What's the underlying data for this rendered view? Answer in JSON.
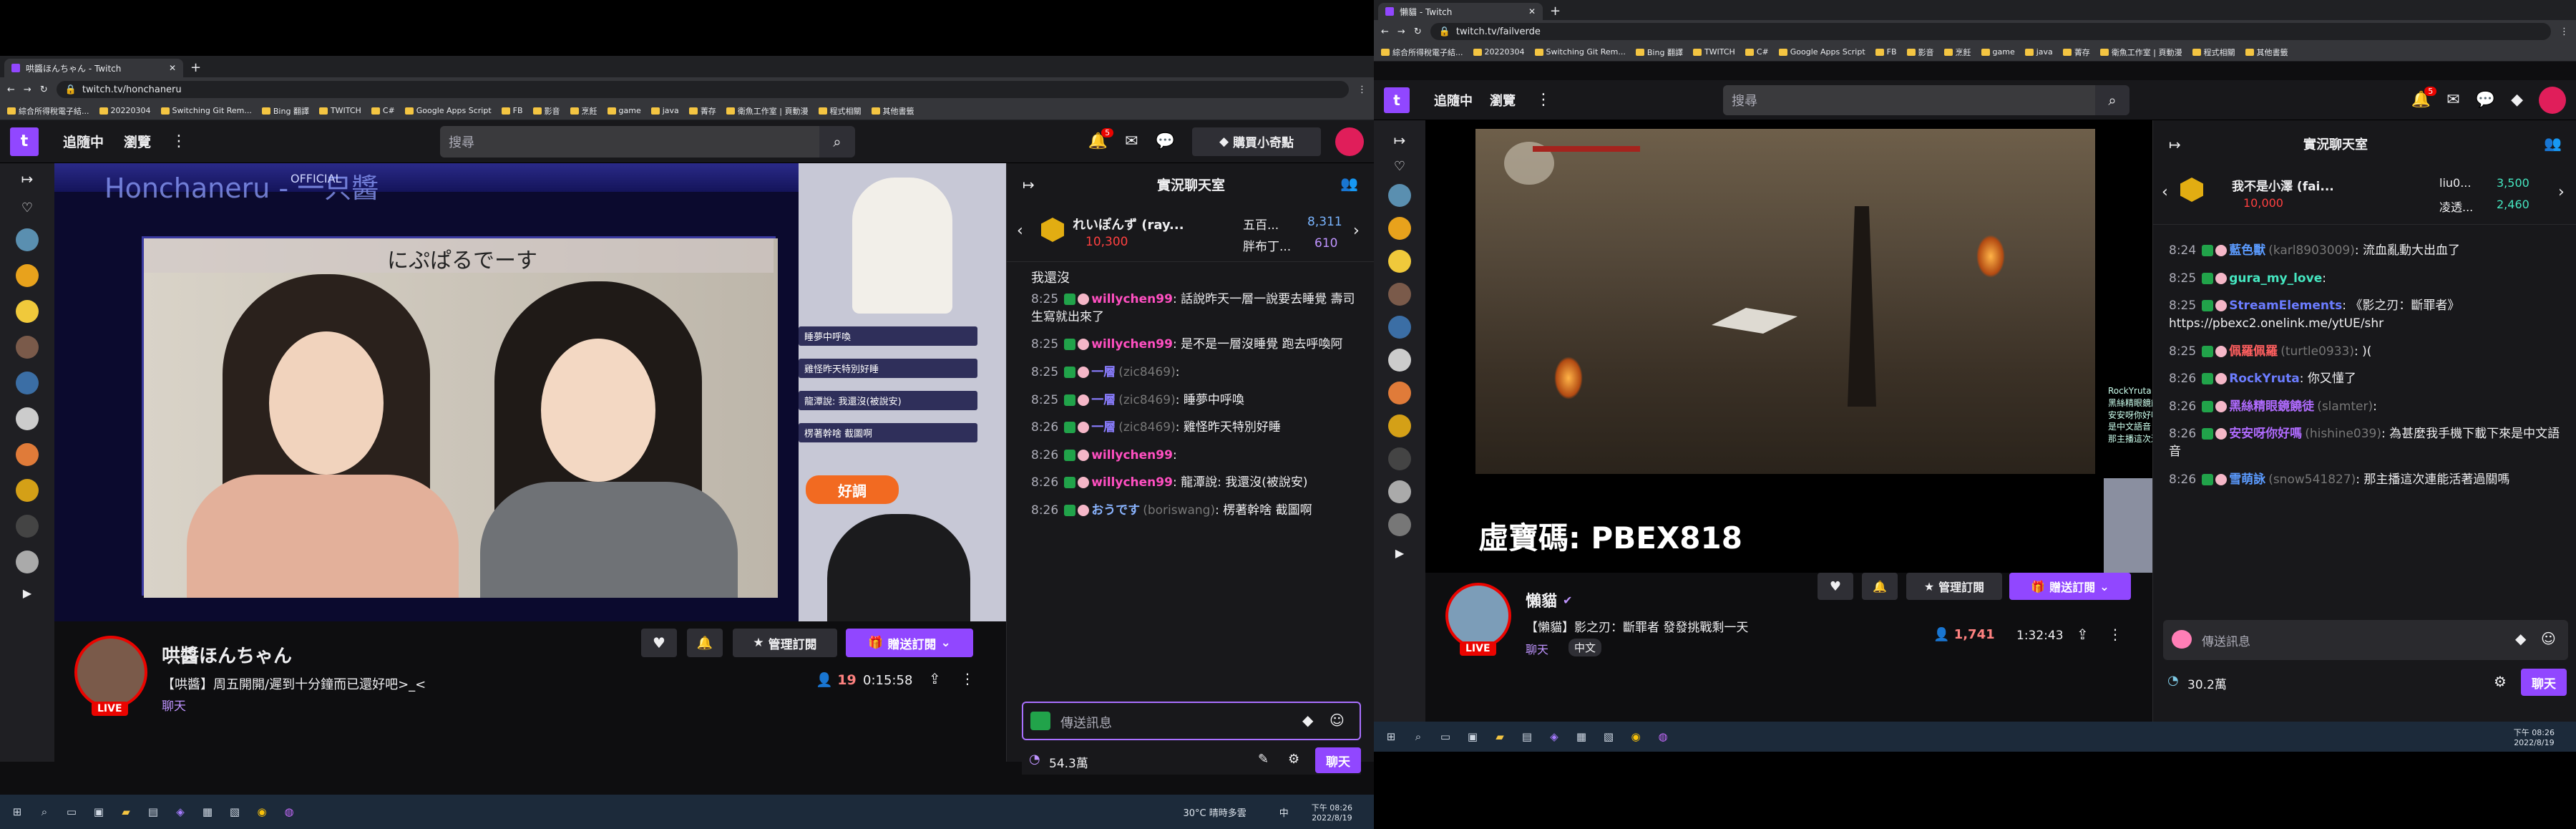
{
  "left": {
    "tab_title": "哄醬ほんちゃん - Twitch",
    "url": "twitch.tv/honchaneru",
    "bookmarks": [
      "綜合所得稅電子結...",
      "20220304",
      "Switching Git Rem...",
      "Bing 翻譯",
      "TWITCH",
      "C#",
      "Google Apps Script",
      "FB",
      "影音",
      "烹飪",
      "game",
      "java",
      "菁存",
      "衛魚工作室 | 頁動漫",
      "程式相關",
      "其他書籤"
    ],
    "nav": {
      "following": "追隨中",
      "browse": "瀏覽",
      "search_placeholder": "搜尋",
      "notif_count": "5",
      "bits_label": "購買小奇點"
    },
    "video": {
      "banner_title": "Honchaneru - 一只醬",
      "official": "OFFICIAL",
      "stream_caption": "にぷぱるでーす",
      "side_overlay": [
        "睡夢中呼喚",
        "雞怪昨天特別好睡",
        "龍潭說: 我還沒(被說安)",
        "楞著幹啥 截圖啊"
      ],
      "good_label": "好調"
    },
    "channel": {
      "name": "哄醬ほんちゃん",
      "title": "【哄醬】周五開開/遲到十分鐘而已還好吧>_<",
      "category": "聊天",
      "live": "LIVE",
      "viewers": "19",
      "uptime": "0:15:58",
      "follow_btn": "管理訂閱",
      "gift_btn": "贈送訂閱"
    },
    "chat": {
      "header": "實況聊天室",
      "pinned": {
        "user": "れいぽんず (ray...",
        "bits": "10,300",
        "user2": "五百...",
        "bits2": "8,311",
        "user3": "胖布丁...",
        "bits3": "610"
      },
      "first_line": "我還沒",
      "messages": [
        {
          "time": "8:25",
          "user": "willychen99",
          "text": ": 話說昨天一層一說要去睡覺 壽司生寫就出來了",
          "color": "#ff4fc1"
        },
        {
          "time": "8:25",
          "user": "willychen99",
          "text": ": 是不是一層沒睡覺 跑去呼喚阿",
          "color": "#ff4fc1"
        },
        {
          "time": "8:25",
          "user": "一層",
          "sub": "(zic8469)",
          "text": ":",
          "color": "#8a7dff"
        },
        {
          "time": "8:25",
          "user": "一層",
          "sub": "(zic8469)",
          "text": ": 睡夢中呼喚",
          "color": "#8a7dff"
        },
        {
          "time": "8:26",
          "user": "一層",
          "sub": "(zic8469)",
          "text": ": 雞怪昨天特別好睡",
          "color": "#8a7dff"
        },
        {
          "time": "8:26",
          "user": "willychen99",
          "text": ":",
          "color": "#ff4fc1"
        },
        {
          "time": "8:26",
          "user": "willychen99",
          "text": ": 龍潭說: 我還沒(被說安)",
          "color": "#ff4fc1"
        },
        {
          "time": "8:26",
          "user": "おうです",
          "sub": "(boriswang)",
          "text": ": 楞著幹啥 截圖啊",
          "color": "#8ab4ff"
        }
      ],
      "input_placeholder": "傳送訊息",
      "points": "54.3萬",
      "send": "聊天"
    },
    "taskbar": {
      "weather": "30°C 晴時多雲",
      "lang": "中",
      "time": "下午 08:26",
      "date": "2022/8/19"
    }
  },
  "right": {
    "tab_title": "懶貓 - Twitch",
    "url": "twitch.tv/failverde",
    "bookmarks": [
      "綜合所得稅電子結...",
      "20220304",
      "Switching Git Rem...",
      "Bing 翻譯",
      "TWITCH",
      "C#",
      "Google Apps Script",
      "FB",
      "影音",
      "烹飪",
      "game",
      "java",
      "菁存",
      "衛魚工作室 | 頁動漫",
      "程式相關",
      "其他書籤"
    ],
    "nav": {
      "following": "追隨中",
      "browse": "瀏覽",
      "search_placeholder": "搜尋",
      "notif_count": "5"
    },
    "video": {
      "code": "虛寶碼: PBEX818",
      "mini_chat": [
        "RockYruta: 你又懂了",
        "黑絲精眼鏡饒徒",
        "安安呀你好嗎: 為甚麼我手機下載下來是中文語音",
        "那主播這次連能活著過關嗎"
      ]
    },
    "channel": {
      "name": "懶貓",
      "title": "【懶貓】影之刃：斷罪者 發發挑戰剩一天",
      "category": "聊天",
      "tag": "中文",
      "live": "LIVE",
      "viewers": "1,741",
      "uptime": "1:32:43",
      "follow_btn": "管理訂閱",
      "gift_btn": "贈送訂閱"
    },
    "chat": {
      "header": "實況聊天室",
      "pinned": {
        "user": "我不是小澤 (fai...",
        "bits": "10,000",
        "user2": "liu0...",
        "bits2": "3,500",
        "user3": "凌透...",
        "bits3": "2,460"
      },
      "messages": [
        {
          "time": "8:24",
          "user": "藍色獸",
          "sub": "(karl8903009)",
          "text": ": 流血亂動大出血了",
          "color": "#5b9bff"
        },
        {
          "time": "8:25",
          "user": "gura_my_love",
          "text": ":",
          "color": "#45e6c0"
        },
        {
          "time": "8:25",
          "user": "StreamElements",
          "text": ": 《影之刃：斷罪者》 https://pbexc2.onelink.me/ytUE/shr",
          "color": "#6b7cff"
        },
        {
          "time": "8:25",
          "user": "佩羅佩羅",
          "sub": "(turtle0933)",
          "text": ": )(",
          "color": "#ff5f5f"
        },
        {
          "time": "8:26",
          "user": "RockYruta",
          "text": ": 你又懂了",
          "color": "#6b7cff"
        },
        {
          "time": "8:26",
          "user": "黑絲精眼鏡饒徒",
          "sub": "(slamter)",
          "text": ":",
          "color": "#b06bff"
        },
        {
          "time": "8:26",
          "user": "安安呀你好嗎",
          "sub": "(hishine039)",
          "text": ": 為甚麼我手機下載下來是中文語音",
          "color": "#b06bff"
        },
        {
          "time": "8:26",
          "user": "雪萌詠",
          "sub": "(snow541827)",
          "text": ": 那主播這次連能活著過關嗎",
          "color": "#5b9bff"
        }
      ],
      "input_placeholder": "傳送訊息",
      "points": "30.2萬",
      "send": "聊天"
    },
    "taskbar": {
      "time": "下午 08:26",
      "date": "2022/8/19"
    }
  }
}
